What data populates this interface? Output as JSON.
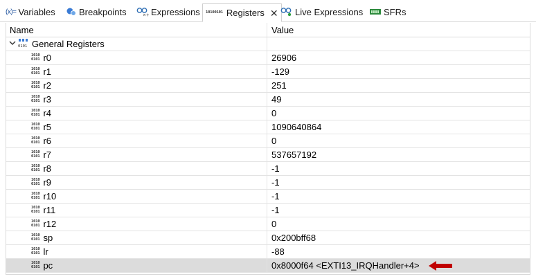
{
  "tabs": [
    {
      "label": "Variables",
      "icon": "variables-icon",
      "icon_text": "(x)="
    },
    {
      "label": "Breakpoints",
      "icon": "breakpoints-icon"
    },
    {
      "label": "Expressions",
      "icon": "expressions-icon"
    },
    {
      "label": "Registers",
      "icon": "registers-icon",
      "active": true
    },
    {
      "label": "Live Expressions",
      "icon": "live-expressions-icon"
    },
    {
      "label": "SFRs",
      "icon": "sfrs-icon"
    }
  ],
  "table": {
    "headers": {
      "name": "Name",
      "value": "Value"
    },
    "group": {
      "label": "General Registers"
    },
    "rows": [
      {
        "name": "r0",
        "value": "26906"
      },
      {
        "name": "r1",
        "value": "-129"
      },
      {
        "name": "r2",
        "value": "251"
      },
      {
        "name": "r3",
        "value": "49"
      },
      {
        "name": "r4",
        "value": "0"
      },
      {
        "name": "r5",
        "value": "1090640864"
      },
      {
        "name": "r6",
        "value": "0"
      },
      {
        "name": "r7",
        "value": "537657192"
      },
      {
        "name": "r8",
        "value": "-1"
      },
      {
        "name": "r9",
        "value": "-1"
      },
      {
        "name": "r10",
        "value": "-1"
      },
      {
        "name": "r11",
        "value": "-1"
      },
      {
        "name": "r12",
        "value": "0"
      },
      {
        "name": "sp",
        "value": "0x200bff68"
      },
      {
        "name": "lr",
        "value": "-88"
      },
      {
        "name": "pc",
        "value": "0x8000f64 <EXTI13_IRQHandler+4>"
      }
    ]
  },
  "colors": {
    "accent_arrow": "#c00000",
    "selected_row": "#dcdcdc"
  }
}
